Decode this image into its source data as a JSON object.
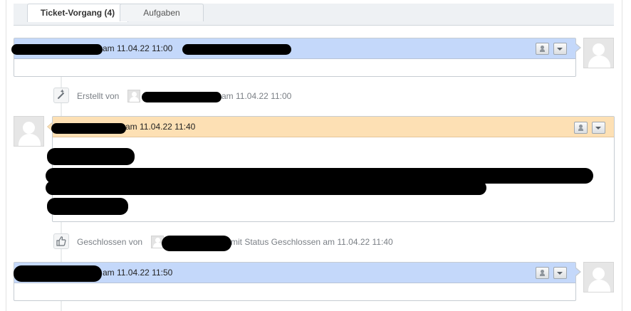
{
  "tabs": [
    {
      "label": "Ticket-Vorgang (4)",
      "active": true
    },
    {
      "label": "Aufgaben",
      "active": false
    }
  ],
  "articles": [
    {
      "meta": "am 11.04.22 11:00",
      "header_color": "#c4d8fa"
    },
    {
      "meta": "am 11.04.22 11:40",
      "header_color": "#fde0b4"
    },
    {
      "meta": "am 11.04.22 11:50",
      "header_color": "#c4d8fa"
    }
  ],
  "events": [
    {
      "icon": "magic-wand-icon",
      "label": "Erstellt von",
      "suffix": "am 11.04.22 11:00"
    },
    {
      "icon": "thumbs-up-icon",
      "label": "Geschlossen von",
      "suffix": "mit Status Geschlossen am 11.04.22 11:40"
    }
  ]
}
